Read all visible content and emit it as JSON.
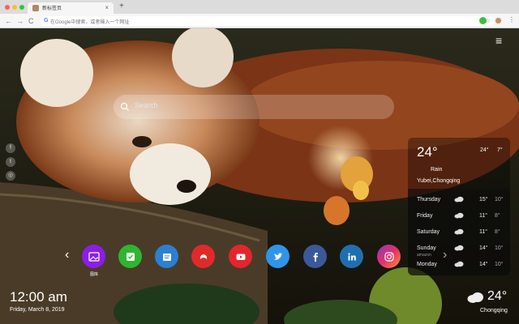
{
  "browser": {
    "tab_title": "新标签页",
    "tab_close": "×",
    "new_tab": "+",
    "back": "←",
    "forward": "→",
    "reload": "C",
    "omnibox_placeholder": "在Google中搜索，或者输入一个网址",
    "google_letter": "G"
  },
  "page": {
    "search_placeholder": "Search",
    "social_icons": [
      "facebook-icon",
      "twitter-icon",
      "share-icon"
    ]
  },
  "weather_panel": {
    "current_temp": "24°",
    "high": "24°",
    "low": "7°",
    "condition": "Rain",
    "location": "Yubei,Chongqing",
    "forecast": [
      {
        "day": "Thursday",
        "high": "15°",
        "low": "10°",
        "sub": ""
      },
      {
        "day": "Friday",
        "high": "11°",
        "low": "8°",
        "sub": ""
      },
      {
        "day": "Saturday",
        "high": "11°",
        "low": "8°",
        "sub": ""
      },
      {
        "day": "Sunday",
        "high": "14°",
        "low": "10°",
        "sub": "amazon"
      },
      {
        "day": "Monday",
        "high": "14°",
        "low": "10°",
        "sub": ""
      }
    ]
  },
  "dock": {
    "apps": [
      "gallery-icon",
      "checklist-icon",
      "notes-icon",
      "gamepad-icon",
      "youtube-icon",
      "twitter-icon",
      "facebook-icon",
      "linkedin-icon",
      "instagram-icon"
    ],
    "first_label": "图库"
  },
  "clock": {
    "time": "12:00 am",
    "date": "Friday, March 8, 2019"
  },
  "bottom_weather": {
    "temp": "24°",
    "city": "Chongqing"
  }
}
